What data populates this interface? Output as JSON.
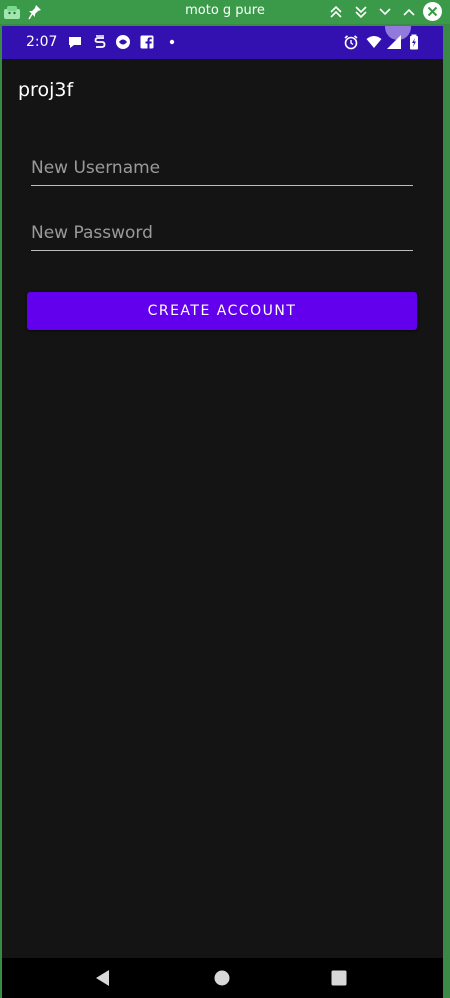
{
  "window": {
    "title": "moto g pure"
  },
  "status_bar": {
    "time": "2:07",
    "notification_icons": [
      "chat-bubble-icon",
      "sync-s-icon",
      "vpn-shield-icon",
      "facebook-icon",
      "more-dot-icon"
    ],
    "system_icons": [
      "alarm-icon",
      "wifi-icon",
      "signal-icon",
      "battery-icon"
    ],
    "background_color": "#3311b0"
  },
  "app": {
    "title": "proj3f",
    "background_color": "#141414"
  },
  "form": {
    "username_placeholder": "New Username",
    "username_value": "",
    "password_placeholder": "New Password",
    "password_value": "",
    "create_button_label": "CREATE ACCOUNT",
    "button_color": "#6200ee"
  },
  "navigation": {
    "buttons": [
      "back-icon",
      "home-icon",
      "recents-icon"
    ]
  }
}
